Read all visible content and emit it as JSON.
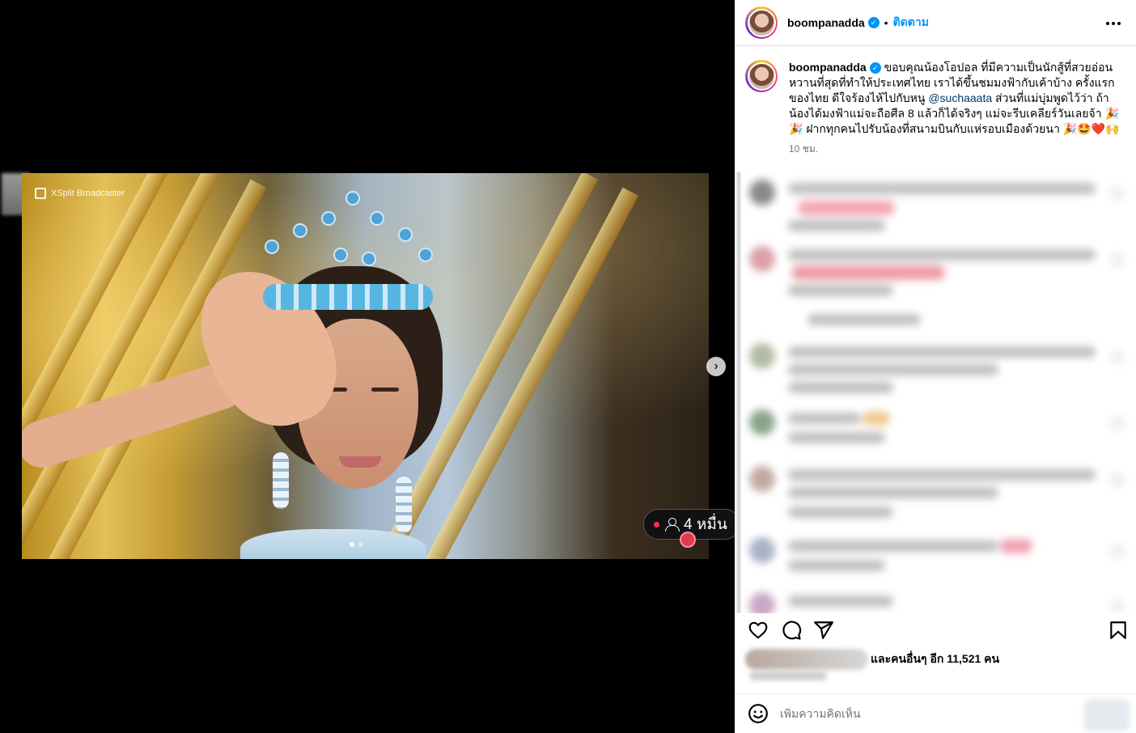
{
  "media": {
    "broadcaster_label": "XSplit Broadcaster",
    "viewer_count": "4 หมื่น",
    "carousel": {
      "total": 2,
      "active": 1
    }
  },
  "header": {
    "username": "boompanadda",
    "separator": "•",
    "follow_label": "ติดตาม"
  },
  "caption": {
    "username": "boompanadda",
    "text_part1": "ขอบคุณน้องโอปอล ที่มีความเป็นนักสู้ที่สวยอ่อนหวานที่สุดที่ทำให้ประเทศไทย เราได้ขึ้นชมมงฟ้ากับเค้าบ้าง ครั้งแรกของไทย ดีใจร้องไห้ไปกับหนู ",
    "mention": "@suchaaata",
    "text_part2": " ส่วนที่แม่บุ่มพูดไว้ว่า ถ้าน้องได้มงฟ้าแม่จะถือศีล 8 แล้วก็ได้จริงๆ แม่จะรีบเคลียร์วันเลยจ้า 🎉 🎉 ฝากทุกคนไปรับน้องที่สนามบินกับแห่รอบเมืองด้วยนา 🎉🤩❤️🙌",
    "time": "10 ชม."
  },
  "actions": {
    "like_icon": "heart-icon",
    "comment_icon": "comment-icon",
    "share_icon": "share-icon",
    "save_icon": "bookmark-icon"
  },
  "likes": {
    "text": "และคนอื่นๆ อีก 11,521 คน"
  },
  "comment_input": {
    "placeholder": "เพิ่มความคิดเห็น"
  },
  "colors": {
    "link": "#0095f6",
    "mention": "#00376b",
    "muted": "#737373"
  }
}
